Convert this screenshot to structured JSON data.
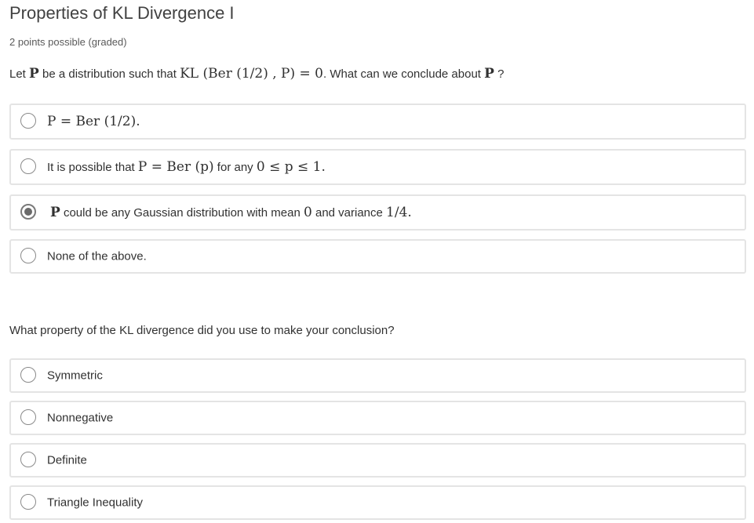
{
  "problem": {
    "title": "Properties of KL Divergence I",
    "points": "2 points possible (graded)"
  },
  "question1": {
    "prompt_parts": {
      "let": "Let ",
      "P": "P",
      "mid": " be a distribution such that ",
      "math": "KL (Ber (1/2) , P) = 0",
      "end": ". What can we conclude about ",
      "P2": "P",
      "q": " ?"
    },
    "options": [
      {
        "math": "P = Ber (1/2).",
        "selected": false
      },
      {
        "text_pre": "It is possible that ",
        "math": "P = Ber (p)",
        "text_mid": " for any ",
        "math2": "0 ≤ p ≤ 1.",
        "selected": false
      },
      {
        "math_pre": "P",
        "text": " could be any Gaussian distribution with mean ",
        "math": "0",
        "text_mid": " and variance ",
        "math2": "1/4.",
        "selected": true
      },
      {
        "text": "None of the above.",
        "selected": false
      }
    ]
  },
  "question2": {
    "prompt": "What property of the KL divergence did you use to make your conclusion?",
    "options": [
      {
        "text": "Symmetric",
        "selected": false
      },
      {
        "text": "Nonnegative",
        "selected": false
      },
      {
        "text": "Definite",
        "selected": false
      },
      {
        "text": "Triangle Inequality",
        "selected": false
      }
    ]
  }
}
